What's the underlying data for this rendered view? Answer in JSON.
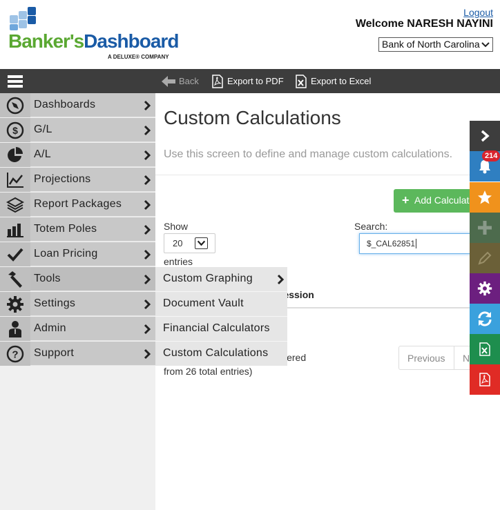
{
  "header": {
    "logo_green": "Banker's",
    "logo_blue": "Dashboard",
    "logo_sub": "A DELUXE® COMPANY",
    "logout": "Logout",
    "welcome": "Welcome  NARESH NAYINI",
    "bank_selected": "Bank of North Carolina"
  },
  "toolbar": {
    "back": "Back",
    "export_pdf": "Export to PDF",
    "export_excel": "Export to Excel"
  },
  "sidebar": {
    "items": [
      {
        "label": "Dashboards",
        "icon": "compass-icon"
      },
      {
        "label": "G/L",
        "icon": "dollar-icon"
      },
      {
        "label": "A/L",
        "icon": "pie-chart-icon"
      },
      {
        "label": "Projections",
        "icon": "line-chart-icon"
      },
      {
        "label": "Report Packages",
        "icon": "layers-icon"
      },
      {
        "label": "Totem Poles",
        "icon": "bar-chart-icon"
      },
      {
        "label": "Loan Pricing",
        "icon": "check-icon"
      },
      {
        "label": "Tools",
        "icon": "hammer-icon"
      },
      {
        "label": "Settings",
        "icon": "gear-icon"
      },
      {
        "label": "Admin",
        "icon": "person-icon"
      },
      {
        "label": "Support",
        "icon": "question-icon"
      }
    ]
  },
  "flyout": {
    "items": [
      {
        "label": "Custom Graphing"
      },
      {
        "label": "Document Vault"
      },
      {
        "label": "Financial Calculators"
      },
      {
        "label": "Custom Calculations"
      }
    ]
  },
  "main": {
    "title": "Custom Calculations",
    "description": "Use this screen to define and manage custom calculations.",
    "add_button": "Add Calculation",
    "show_label": "Show",
    "show_value": "20",
    "entries_label": "entries",
    "search_label": "Search:",
    "search_value": "$_CAL62851",
    "column_header": "ression",
    "info_line1": "iltered",
    "info_line2": "from 26 total entries)",
    "previous": "Previous",
    "next": "N"
  },
  "rail": {
    "notification_count": "214",
    "colors": {
      "expand": "#3d3d3d",
      "notifications": "#2f7fc1",
      "favorites": "#f0921c",
      "add": "#4d6b4d",
      "edit": "#6b6038",
      "settings": "#6c1f7f",
      "refresh": "#3aa1dd",
      "excel": "#1e8e4e",
      "pdf": "#e02b25"
    }
  }
}
